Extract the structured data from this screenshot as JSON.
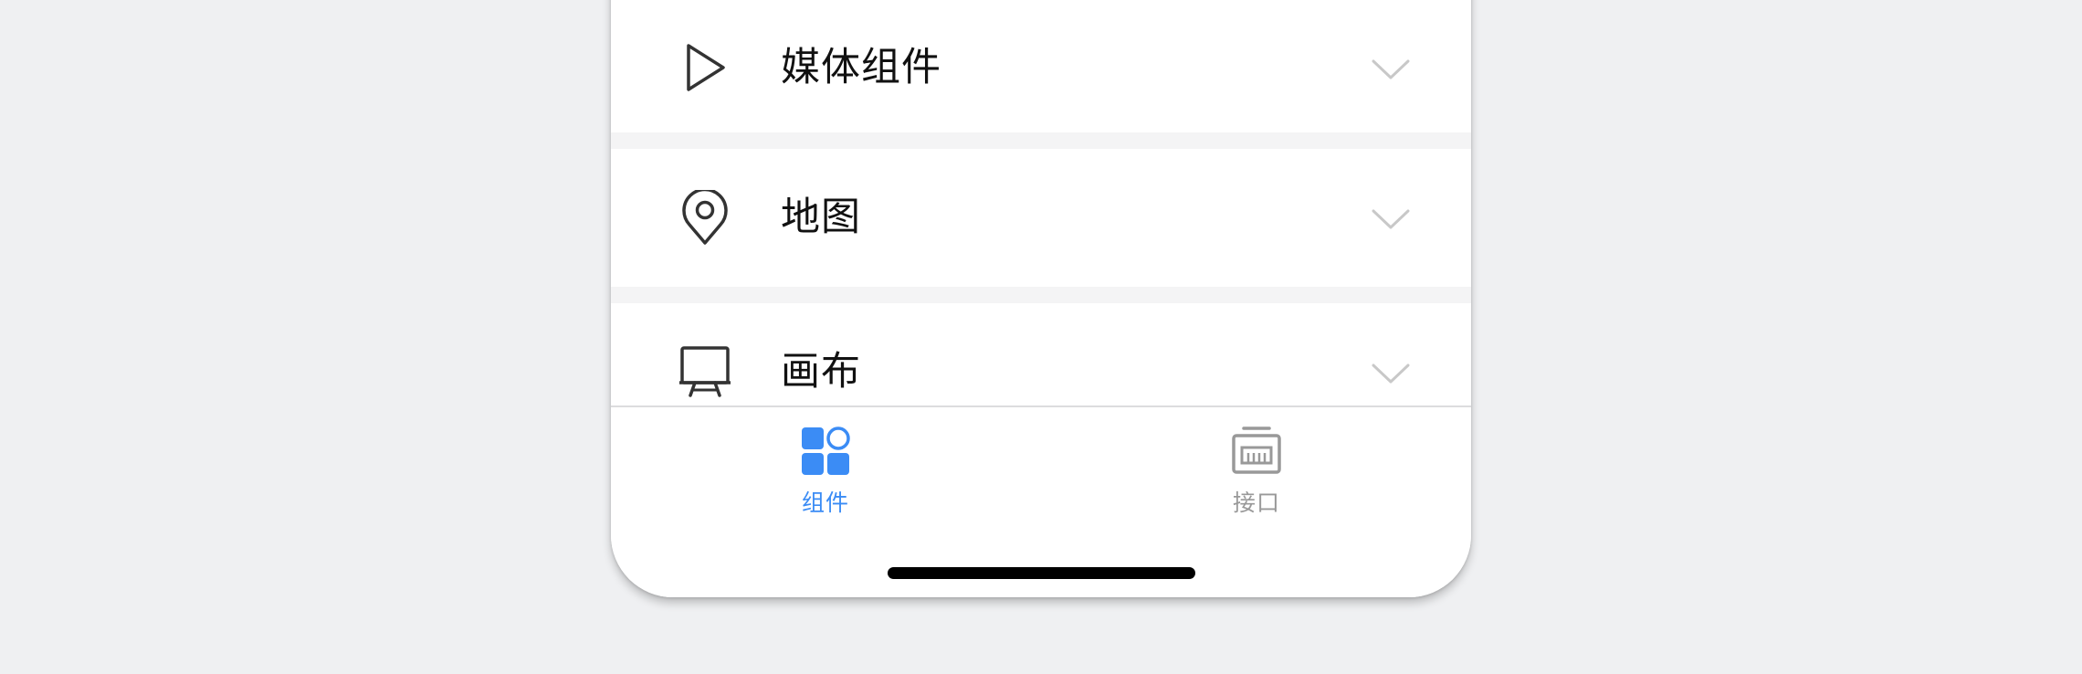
{
  "sections": [
    {
      "id": "media",
      "label": "媒体组件",
      "icon": "play-icon",
      "expanded": false
    },
    {
      "id": "map",
      "label": "地图",
      "icon": "map-pin-icon",
      "expanded": false
    },
    {
      "id": "canvas",
      "label": "画布",
      "icon": "easel-icon",
      "expanded": false
    }
  ],
  "tabbar": {
    "components": {
      "label": "组件",
      "icon": "components-grid-icon",
      "active": true
    },
    "api": {
      "label": "接口",
      "icon": "api-tray-icon",
      "active": false
    }
  },
  "colors": {
    "accent": "#3b8cf5",
    "inactive_tab": "#999999",
    "background": "#eff0f2",
    "section_gap": "#f4f4f5",
    "chevron": "#c8c8c8"
  }
}
